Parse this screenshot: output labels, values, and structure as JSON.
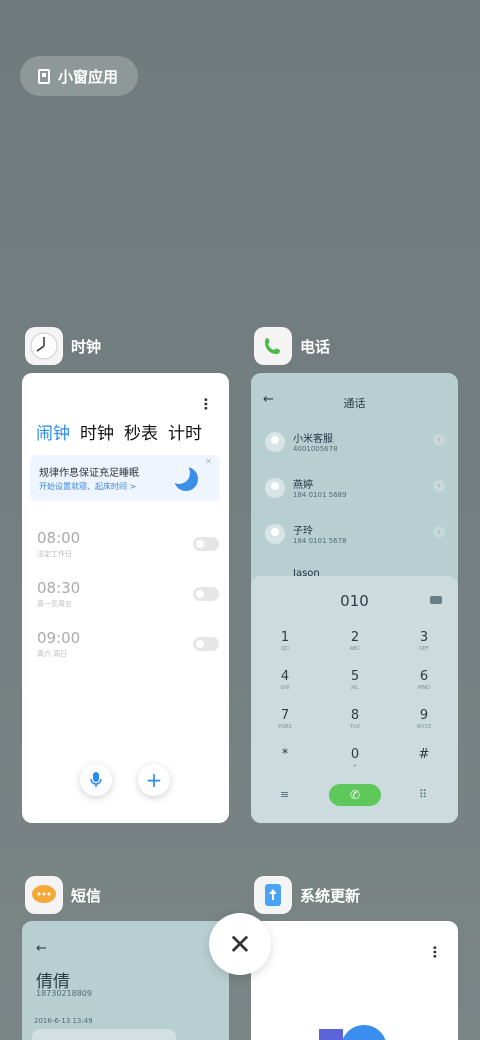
{
  "floating_button": {
    "label": "小窗应用",
    "icon": "small-window-icon"
  },
  "apps": {
    "clock": {
      "name": "时钟",
      "icon": "clock-icon"
    },
    "phone": {
      "name": "电话",
      "icon": "phone-icon"
    },
    "sms": {
      "name": "短信",
      "icon": "message-icon"
    },
    "update": {
      "name": "系统更新",
      "icon": "update-icon"
    }
  },
  "clock": {
    "tabs": [
      "闹钟",
      "时钟",
      "秒表",
      "计时"
    ],
    "banner": {
      "title": "规律作息保证充足睡眠",
      "subtitle": "开始设置就寝、起床时间 >"
    },
    "alarms": [
      {
        "time": "08:00",
        "days": "法定工作日"
      },
      {
        "time": "08:30",
        "days": "周一至周五"
      },
      {
        "time": "09:00",
        "days": "周六 周日"
      }
    ]
  },
  "phone": {
    "title": "通话",
    "contacts": [
      {
        "name": "小米客服",
        "number": "4001005678"
      },
      {
        "name": "燕婷",
        "number": "184 0101 5689"
      },
      {
        "name": "子玲",
        "number": "184 0101 5678"
      },
      {
        "name": "Jason",
        "number": ""
      }
    ],
    "dialed": "010",
    "keys": [
      {
        "d": "1",
        "l": "QO"
      },
      {
        "d": "2",
        "l": "ABC"
      },
      {
        "d": "3",
        "l": "DEF"
      },
      {
        "d": "4",
        "l": "GHI"
      },
      {
        "d": "5",
        "l": "JKL"
      },
      {
        "d": "6",
        "l": "MNO"
      },
      {
        "d": "7",
        "l": "PQRS"
      },
      {
        "d": "8",
        "l": "TUV"
      },
      {
        "d": "9",
        "l": "WXYZ"
      },
      {
        "d": "*",
        "l": ","
      },
      {
        "d": "0",
        "l": "+"
      },
      {
        "d": "#",
        "l": ""
      }
    ]
  },
  "sms": {
    "contact_name": "倩倩",
    "contact_number": "18730218809",
    "date": "2016-6-13 13:49"
  },
  "close_label": "✕"
}
